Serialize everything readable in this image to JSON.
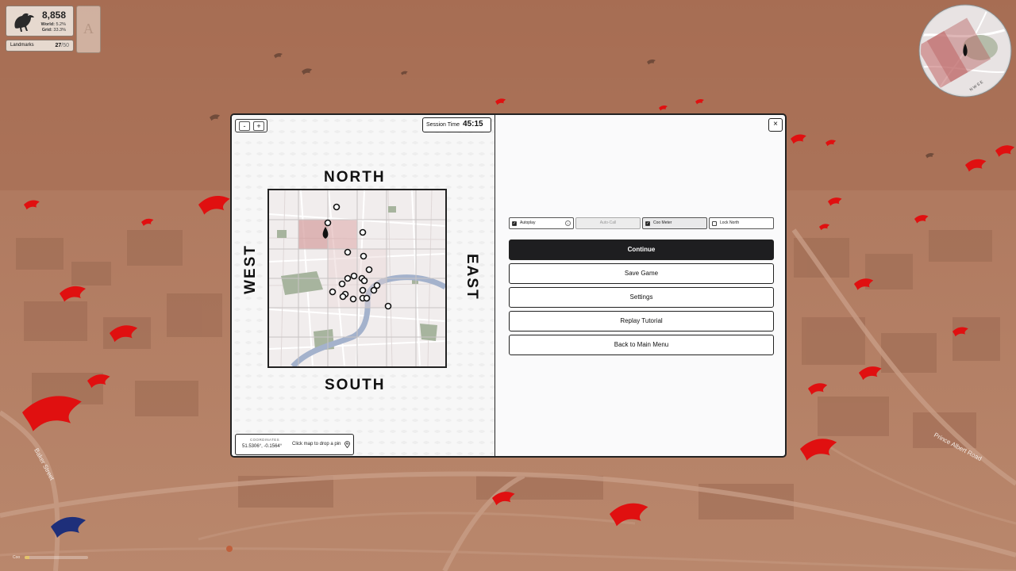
{
  "hud": {
    "score": "8,858",
    "world_label": "World:",
    "world_value": "5.2%",
    "grid_label": "Grid:",
    "grid_value": "33.3%",
    "landmarks_label": "Landmarks",
    "landmarks_current": "27",
    "landmarks_total": "/50",
    "card_letter": "A"
  },
  "street_labels": {
    "baker_street": "Baker Street",
    "prince_albert_road": "Prince Albert Road"
  },
  "minimap": {
    "directions": "N W S E"
  },
  "dialog": {
    "zoom_out": "-",
    "zoom_in": "+",
    "session_label": "Session Time",
    "session_time": "45:15",
    "compass": {
      "north": "NORTH",
      "south": "SOUTH",
      "west": "WEST",
      "east": "EAST"
    },
    "coordinates_label": "COORDINATES",
    "coordinates_value": "51.5306°, -0.1564°",
    "coordinates_hint": "Click map to drop a pin",
    "close": "×",
    "toggles": [
      {
        "label": "Autoplay",
        "checked": true,
        "state": "enabled"
      },
      {
        "label": "Auto-Call",
        "checked": false,
        "state": "disabled"
      },
      {
        "label": "Coo Meter",
        "checked": true,
        "state": "active"
      },
      {
        "label": "Lock North",
        "checked": false,
        "state": "enabled"
      }
    ],
    "menu": {
      "continue": "Continue",
      "save": "Save Game",
      "settings": "Settings",
      "tutorial": "Replay Tutorial",
      "main_menu": "Back to Main Menu"
    }
  },
  "coo_meter": {
    "label": "Coo",
    "level": 0.08
  },
  "colors": {
    "scene_tint": "#a9765c",
    "pigeon_red": "#e01010",
    "pigeon_blue": "#1e2f7a",
    "primary_button": "#1e1e20"
  }
}
